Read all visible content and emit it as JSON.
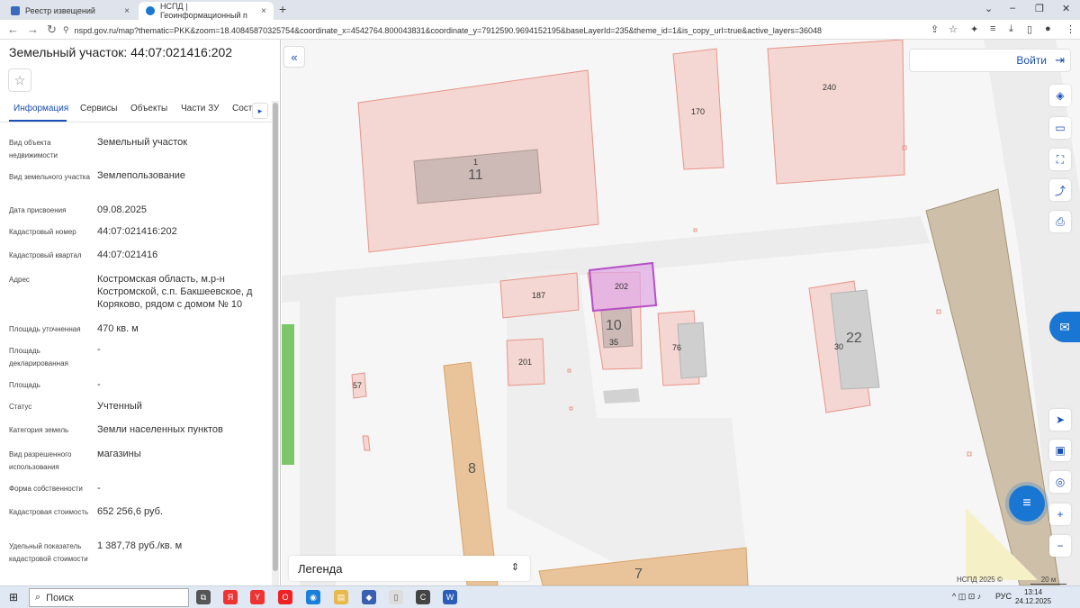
{
  "browser": {
    "tabs": [
      {
        "label": "Реестр извещений",
        "close": "×"
      },
      {
        "label": "НСПД | Геоинформационный п",
        "close": "×"
      }
    ],
    "new_tab": "+",
    "window_controls": {
      "chevron": "⌄",
      "minimize": "–",
      "maximize": "❐",
      "close": "✕"
    },
    "nav": {
      "back": "←",
      "forward": "→",
      "reload": "↻"
    },
    "url": "nspd.gov.ru/map?thematic=PKK&zoom=18.40845870325754&coordinate_x=4542764.800043831&coordinate_y=7912590.9694152195&baseLayerId=235&theme_id=1&is_copy_url=true&active_layers=36048",
    "toolbar_icons": [
      "⇪",
      "☆",
      "✦",
      "≡",
      "⤓",
      "▯",
      "●",
      "⋮"
    ]
  },
  "panel": {
    "title": "Земельный участок: 44:07:021416:202",
    "star": "☆",
    "tabs": [
      "Информация",
      "Сервисы",
      "Объекты",
      "Части ЗУ",
      "Соста"
    ],
    "tab_next": "▸",
    "rows": [
      {
        "label": "Вид объекта недвижимости",
        "value": "Земельный участок"
      },
      {
        "label": "Вид земельного участка",
        "value": "Землепользование"
      },
      {
        "label": "Дата присвоения",
        "value": "09.08.2025"
      },
      {
        "label": "Кадастровый номер",
        "value": "44:07:021416:202"
      },
      {
        "label": "Кадастровый квартал",
        "value": "44:07:021416"
      },
      {
        "label": "Адрес",
        "value": "Костромская область, м.р-н Костромской, с.п. Бакшеевское, д Коряково, рядом с домом № 10"
      },
      {
        "label": "Площадь уточненная",
        "value": "470 кв. м"
      },
      {
        "label": "Площадь декларированная",
        "value": "-"
      },
      {
        "label": "Площадь",
        "value": "-"
      },
      {
        "label": "Статус",
        "value": "Учтенный"
      },
      {
        "label": "Категория земель",
        "value": "Земли населенных пунктов"
      },
      {
        "label": "Вид разрешенного использования",
        "value": "магазины"
      },
      {
        "label": "Форма собственности",
        "value": "-"
      },
      {
        "label": "Кадастровая стоимость",
        "value": "652 256,6 руб."
      },
      {
        "label": "Удельный показатель кадастровой стоимости",
        "value": "1 387,78 руб./кв. м"
      }
    ]
  },
  "map": {
    "collapse": "«",
    "login_label": "Войти",
    "login_icon": "⇥",
    "parcel_labels": [
      "240",
      "170",
      "1",
      "187",
      "202",
      "35",
      "76",
      "30",
      "201",
      "57"
    ],
    "big_numbers": [
      "11",
      "10",
      "22",
      "8",
      "7"
    ],
    "tools": [
      "◈",
      "▭",
      "⛶",
      "⤴",
      "⎙"
    ],
    "right_tools": [
      "➤",
      "▣",
      "◎",
      "+",
      "−"
    ],
    "side_badge": "✉",
    "chat": "≡",
    "legend": "Легенда",
    "legend_chevron": "⇕",
    "copyright": "НСПД 2025 ©",
    "scale": "20 м",
    "colors": {
      "selected": "#b64fc6",
      "parcel": "#e8958a",
      "road": "#d9a46b"
    }
  },
  "taskbar": {
    "start": "⊞",
    "search_placeholder": "Поиск",
    "search_icon": "⌕",
    "apps": [
      "⧉",
      "Я",
      "Y",
      "O",
      "◉",
      "▤",
      "◆",
      "▯",
      "C",
      "W"
    ],
    "tray_icons": "^ ◫ ⊡ ♪",
    "language": "РУС",
    "time": "13:14",
    "date": "24.12.2025"
  }
}
